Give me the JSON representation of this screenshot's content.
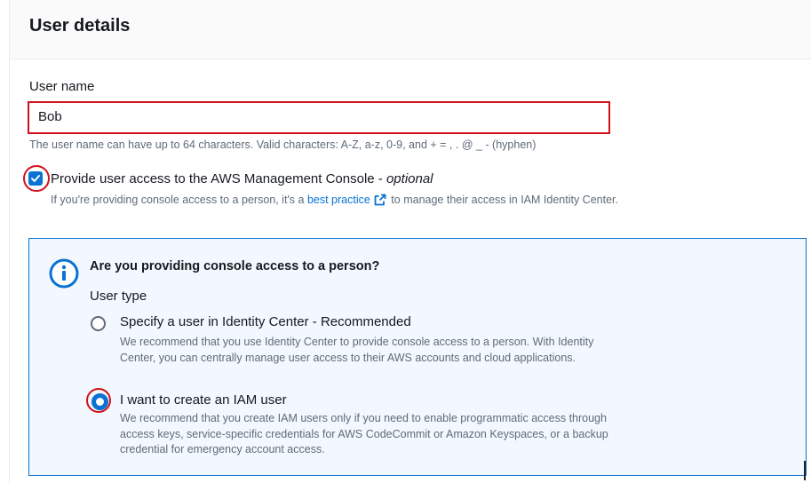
{
  "panel": {
    "title": "User details"
  },
  "user_name": {
    "label": "User name",
    "value": "Bob",
    "hint": "The user name can have up to 64 characters. Valid characters: A-Z, a-z, 0-9, and + = , . @ _ - (hyphen)"
  },
  "console_access": {
    "checked": true,
    "label": "Provide user access to the AWS Management Console - ",
    "label_optional": "optional",
    "desc_before": "If you're providing console access to a person, it's a ",
    "desc_link": "best practice",
    "desc_after": " to manage their access in IAM Identity Center.",
    "link_icon": "external-link-icon"
  },
  "info_box": {
    "icon": "info-icon",
    "title": "Are you providing console access to a person?",
    "user_type_label": "User type",
    "options": [
      {
        "label": "Specify a user in Identity Center - Recommended",
        "desc": "We recommend that you use Identity Center to provide console access to a person. With Identity Center, you can centrally manage user access to their AWS accounts and cloud applications.",
        "selected": false
      },
      {
        "label": "I want to create an IAM user",
        "desc": "We recommend that you create IAM users only if you need to enable programmatic access through access keys, service-specific credentials for AWS CodeCommit or Amazon Keyspaces, or a backup credential for emergency account access.",
        "selected": true
      }
    ]
  },
  "colors": {
    "accent": "#0972d3",
    "highlight_annotation": "#d0111c",
    "info_background": "#f2f8fd"
  }
}
